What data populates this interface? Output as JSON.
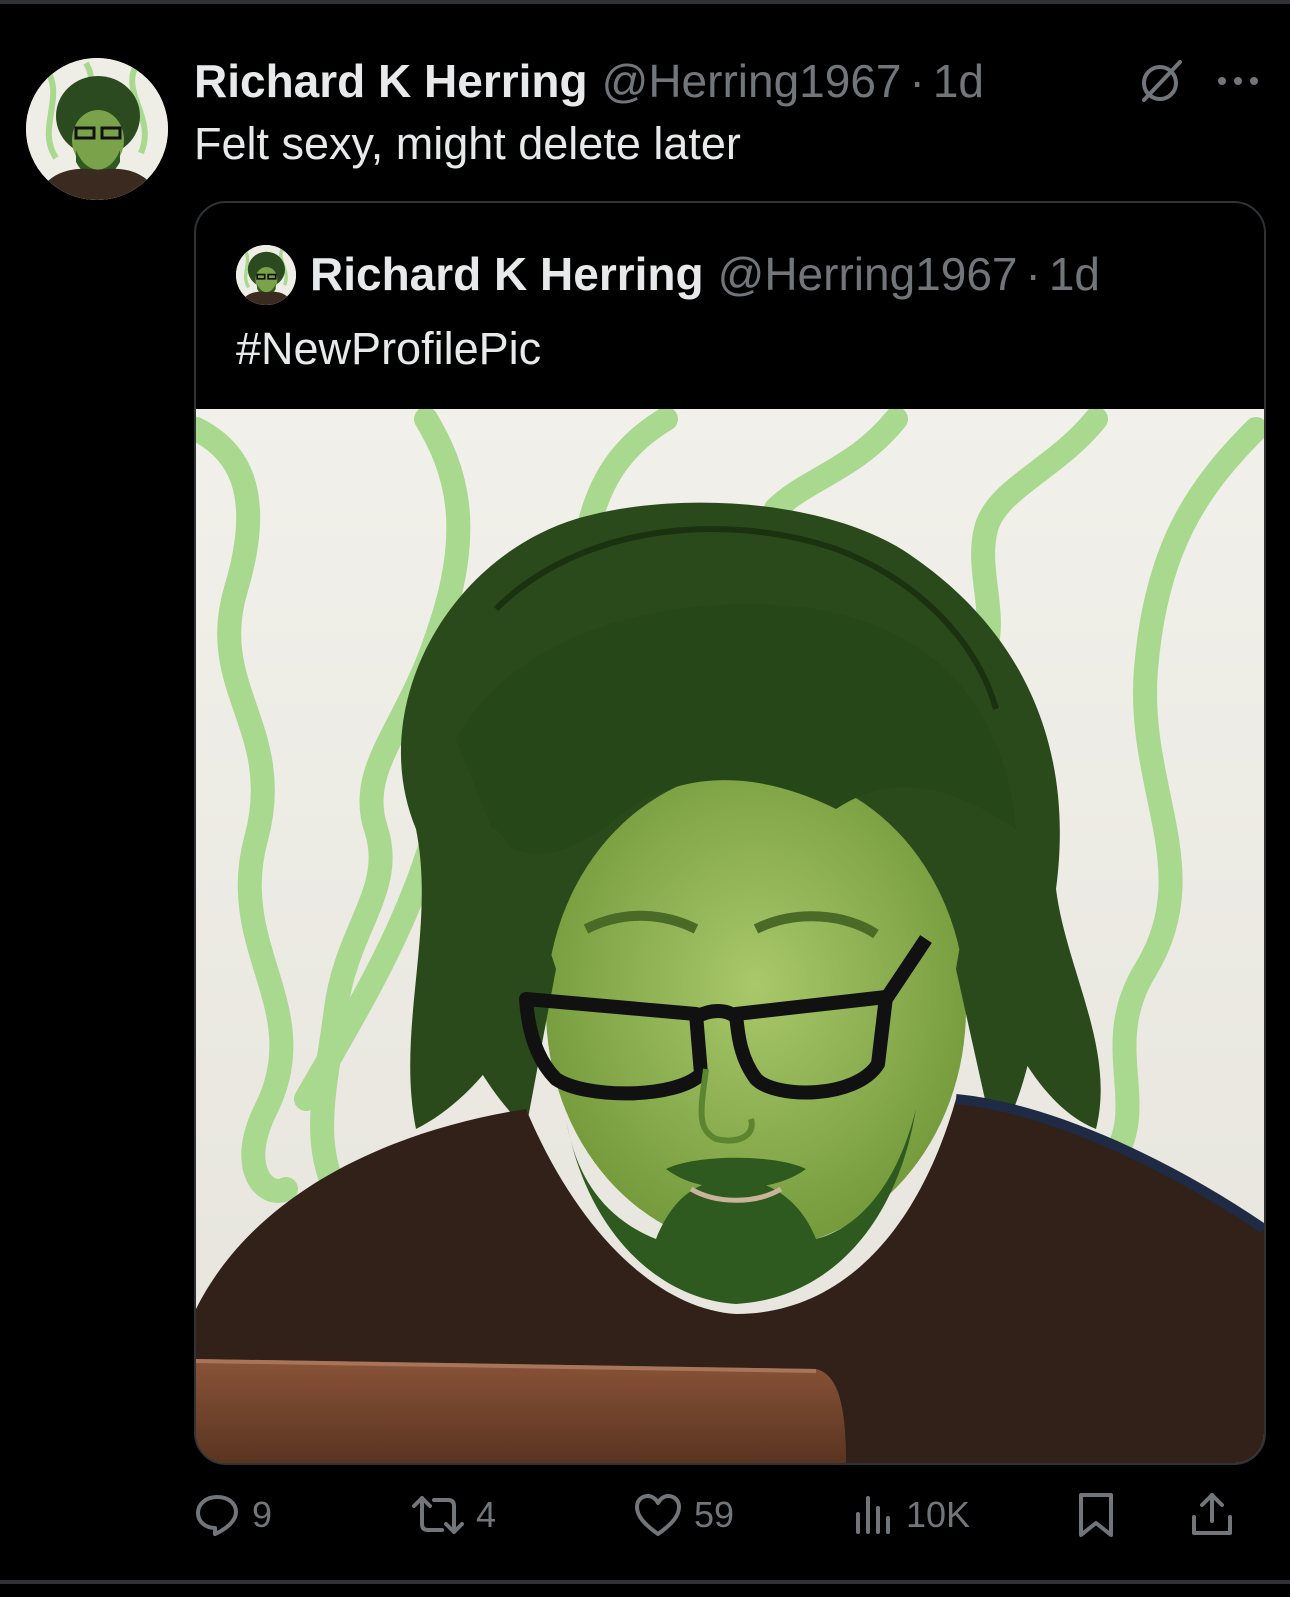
{
  "tweet": {
    "author": {
      "display_name": "Richard K Herring",
      "handle": "@Herring1967",
      "separator": "·",
      "time": "1d"
    },
    "text": "Felt sexy, might delete later",
    "quoted": {
      "author": {
        "display_name": "Richard K Herring",
        "handle": "@Herring1967",
        "separator": "·",
        "time": "1d"
      },
      "text": "#NewProfilePic"
    },
    "stats": {
      "replies": "9",
      "reposts": "4",
      "likes": "59",
      "views": "10K"
    }
  },
  "icons": {
    "grok": "grok-icon",
    "more": "more-options-icon",
    "reply": "reply-icon",
    "repost": "repost-icon",
    "like": "heart-icon",
    "views": "views-icon",
    "bookmark": "bookmark-icon",
    "share": "share-icon"
  },
  "colors": {
    "background": "#000000",
    "text_primary": "#e7e9ea",
    "text_secondary": "#71767b",
    "border": "#2f3336"
  }
}
